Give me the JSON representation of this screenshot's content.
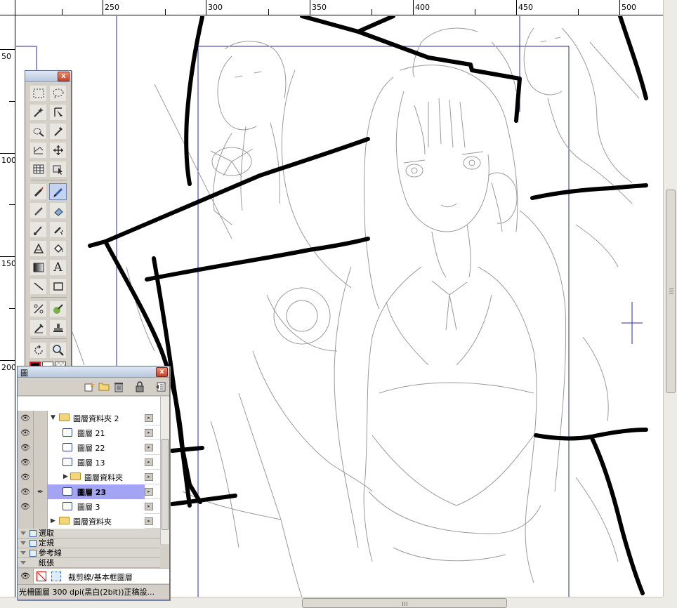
{
  "ruler_top": {
    "labels": [
      "250",
      "300",
      "350",
      "400",
      "450",
      "500"
    ]
  },
  "ruler_left": {
    "labels": [
      "50",
      "100",
      "150",
      "200"
    ]
  },
  "toolbox": {
    "close_label": "x",
    "tools": [
      [
        "marquee-icon",
        "lasso-icon"
      ],
      [
        "magic-wand-icon",
        "select-pen-icon"
      ],
      [
        "select-brush-icon",
        "eyedropper-icon"
      ],
      [
        "transform-icon",
        "move-icon"
      ],
      [
        "grid-icon",
        "object-select-icon"
      ],
      [
        "marker-icon",
        "pen-icon"
      ],
      [
        "pencil-icon",
        "eraser-icon"
      ],
      [
        "brush-icon",
        "airbrush-icon"
      ],
      [
        "pattern-pen-icon",
        "fill-icon"
      ],
      [
        "gradient-icon",
        "text-icon"
      ],
      [
        "line-icon",
        "rectangle-icon"
      ],
      [
        "ruler-icon",
        "tone-icon"
      ],
      [
        "pipette-icon",
        "stamp-icon"
      ],
      [
        "rotate-icon",
        "zoom-icon"
      ]
    ],
    "text_tool_glyph": "A",
    "active_tool": "pen-icon"
  },
  "layers_panel": {
    "title": "圖",
    "close_label": "x",
    "rows": [
      {
        "name": "圖層資料夾 2",
        "type": "folder",
        "expanded": true,
        "indent": 1,
        "visible": true,
        "selected": false
      },
      {
        "name": "圖層 21",
        "type": "layer",
        "indent": 2,
        "visible": true,
        "selected": false
      },
      {
        "name": "圖層 22",
        "type": "layer",
        "indent": 2,
        "visible": true,
        "selected": false
      },
      {
        "name": "圖層 13",
        "type": "layer",
        "indent": 2,
        "visible": true,
        "selected": false
      },
      {
        "name": "圖層資料夾",
        "type": "folder",
        "expanded": false,
        "indent": 2,
        "visible": true,
        "selected": false
      },
      {
        "name": "圖層 23",
        "type": "layer",
        "indent": 2,
        "visible": true,
        "selected": true
      },
      {
        "name": "圖層 3",
        "type": "layer",
        "indent": 2,
        "visible": true,
        "selected": false
      },
      {
        "name": "圖層資料夾",
        "type": "folder",
        "expanded": false,
        "indent": 1,
        "visible": false,
        "selected": false
      }
    ],
    "sections": [
      "選取",
      "定規",
      "參考線",
      "紙張"
    ],
    "paper_row": {
      "name": "裁剪線/基本框圖層"
    },
    "status_text": "光柵圖層 300 dpi(黑白(2bit))正稿設..."
  },
  "colors": {
    "window_bg": "#d4d0c8",
    "selected_layer": "#a4a4f4",
    "guide_blue": "#2a2aa0",
    "sketch_gray": "#8a8a8a"
  }
}
